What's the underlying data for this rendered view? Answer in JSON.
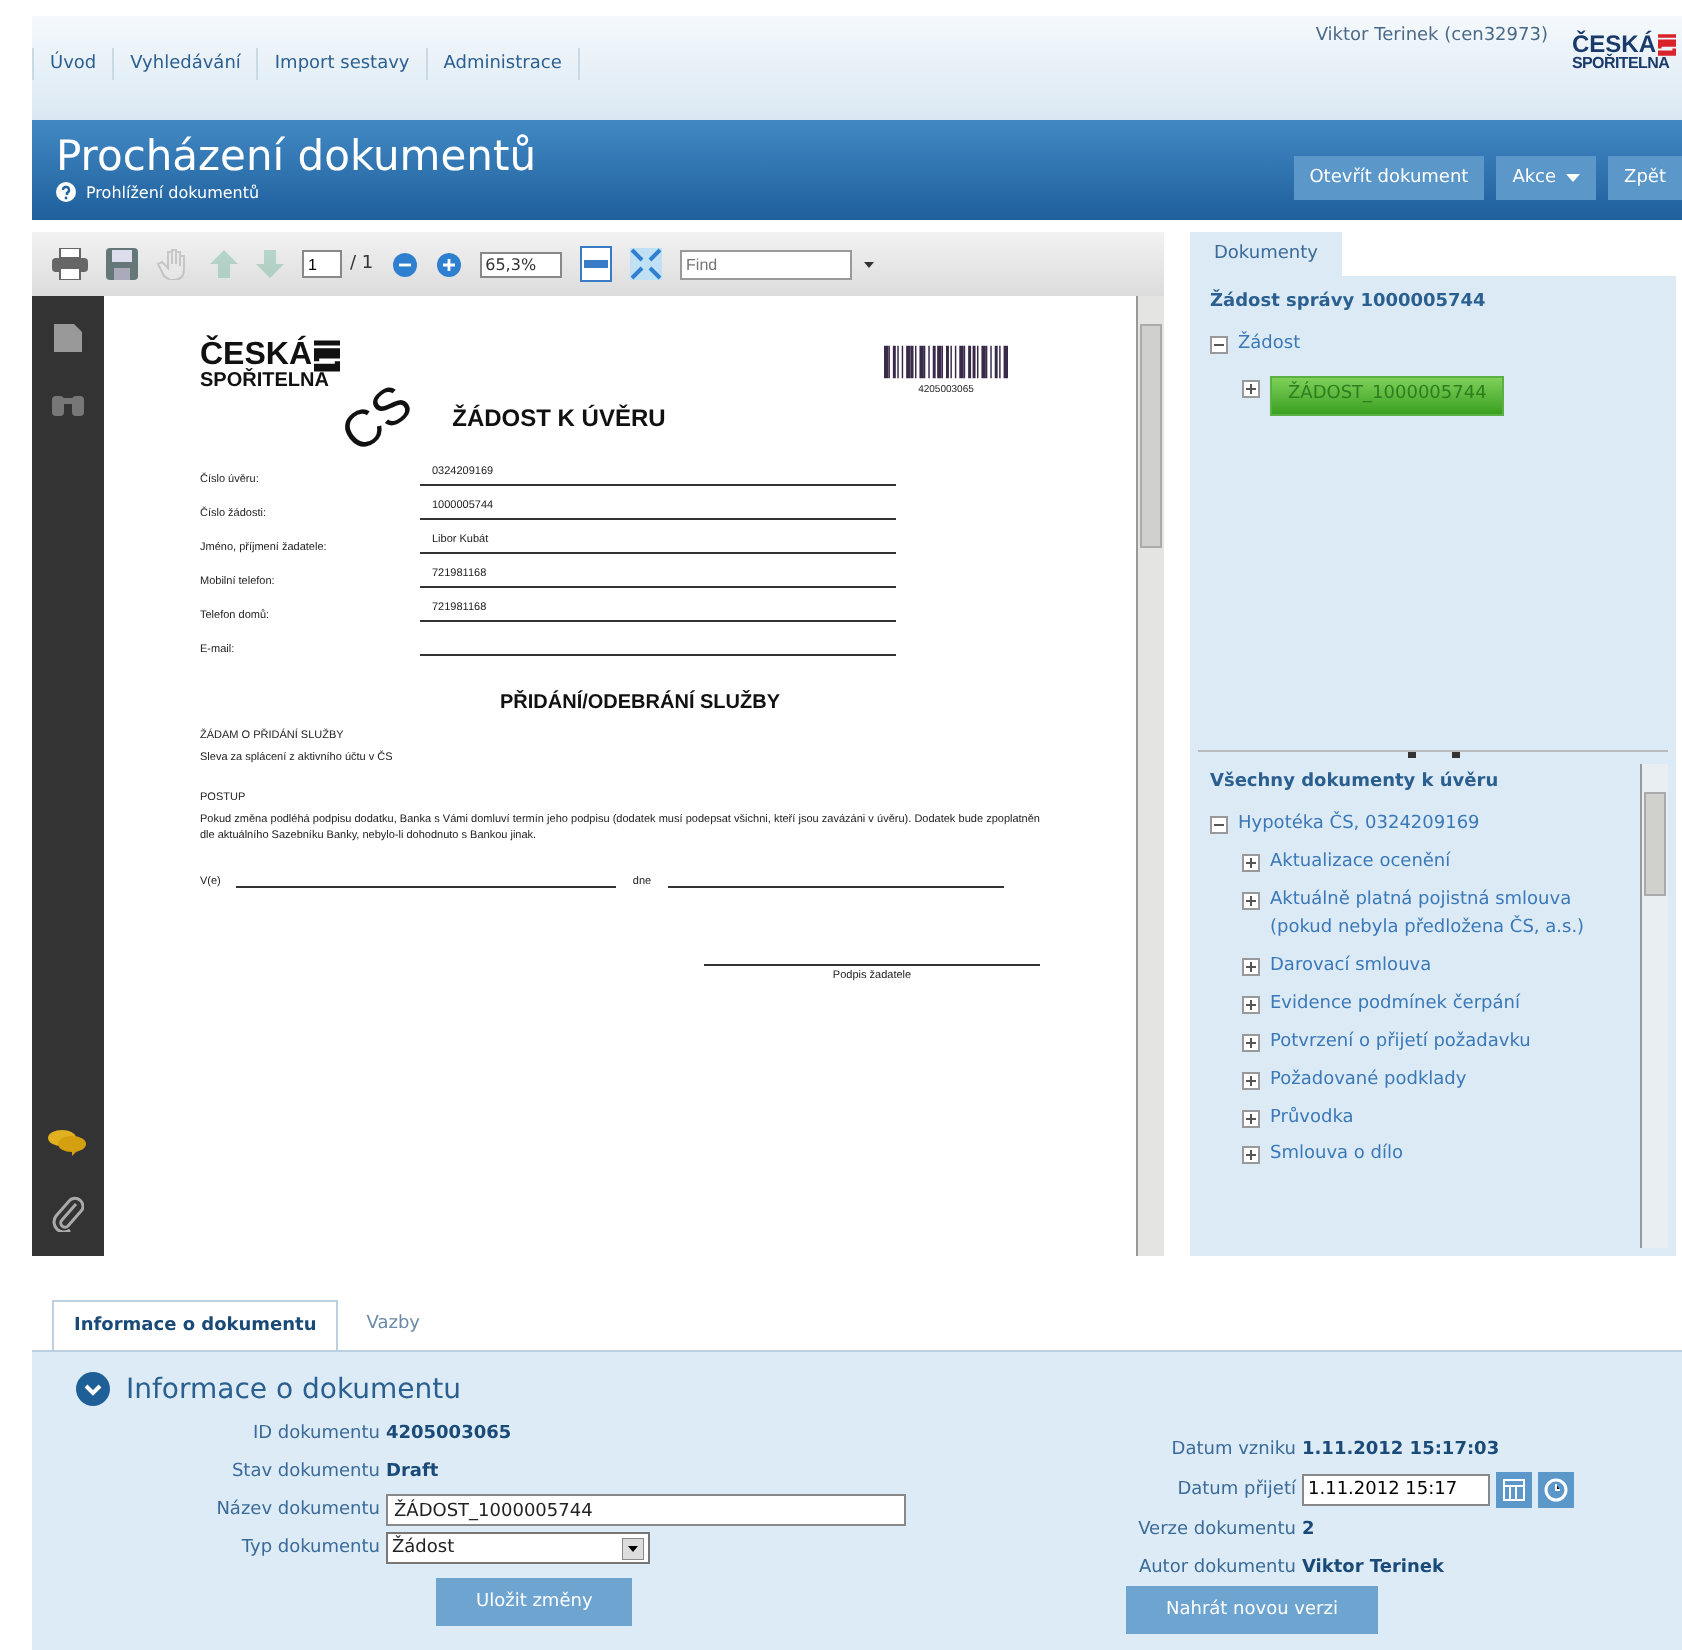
{
  "nav": {
    "items": [
      {
        "label": "Úvod"
      },
      {
        "label": "Vyhledávání"
      },
      {
        "label": "Import sestavy"
      },
      {
        "label": "Administrace"
      }
    ],
    "user": "Viktor Terinek (cen32973)",
    "logo": [
      "ČESKÁ",
      "SPOŘITELNA"
    ]
  },
  "title_bar": {
    "title": "Procházení dokumentů",
    "breadcrumb": "Prohlížení dokumentů",
    "buttons": [
      {
        "label": "Otevřít dokument",
        "dropdown": false
      },
      {
        "label": "Akce",
        "dropdown": true
      },
      {
        "label": "Zpět",
        "dropdown": false
      }
    ]
  },
  "viewer": {
    "tools": [
      {
        "kind": "print",
        "disabled": false
      },
      {
        "kind": "save",
        "disabled": false
      },
      {
        "kind": "hand",
        "disabled": true
      },
      {
        "kind": "prev",
        "disabled": true
      },
      {
        "kind": "next",
        "disabled": true
      },
      {
        "kind": "page"
      },
      {
        "kind": "zoom-out",
        "disabled": false
      },
      {
        "kind": "zoom-in",
        "disabled": false
      },
      {
        "kind": "zoom"
      },
      {
        "kind": "fit",
        "disabled": false
      },
      {
        "kind": "fullscreen",
        "disabled": false
      },
      {
        "kind": "find"
      }
    ],
    "page": "1",
    "page_count": "/ 1",
    "zoom": "65,3%",
    "find_placeholder": "Find",
    "document": {
      "logo": [
        "ČESKÁ",
        "SPOŘITELNA"
      ],
      "barcode_number": "4205003065",
      "stamp": "CS",
      "title": "ŽÁDOST K ÚVĚRU",
      "fields": [
        {
          "label": "Číslo úvěru:",
          "value": "0324209169"
        },
        {
          "label": "Číslo žádosti:",
          "value": "1000005744"
        },
        {
          "label": "Jméno, příjmení žadatele:",
          "value": "Libor Kubát"
        },
        {
          "label": "Mobilní telefon:",
          "value": "721981168"
        },
        {
          "label": "Telefon domů:",
          "value": "721981168"
        },
        {
          "label": "E-mail:"
        }
      ],
      "section_title": "PŘIDÁNÍ/ODEBRÁNÍ SLUŽBY",
      "request": "ŽÁDAM O PŘIDÁNÍ SLUŽBY",
      "service": "Sleva za splácení z aktivního účtu v ČS",
      "procedure_heading": "POSTUP",
      "procedure_text": "Pokud změna podléhá podpisu dodatku, Banka s Vámi domluví termín jeho podpisu (dodatek musí podepsat všichni, kteří jsou zavázáni v úvěru). Dodatek bude zpoplatněn dle aktuálního Sazebníku Banky, nebylo-li dohodnuto s Bankou jinak.",
      "place_label": "V(e)",
      "date_label": "dne",
      "signature_label": "Podpis žadatele"
    }
  },
  "documents_panel": {
    "tabs": [
      {
        "label": "Dokumenty",
        "selected": true
      }
    ],
    "title": "Žádost správy 1000005744",
    "tree": [
      {
        "label": "Žádost",
        "expanded": true,
        "children": [
          {
            "label": "ŽÁDOST_1000005744",
            "expanded": false,
            "selected": true
          }
        ]
      }
    ],
    "all_title": "Všechny dokumenty k úvěru",
    "all_tree": [
      {
        "label": "Hypotéka ČS, 0324209169",
        "expanded": true,
        "children": [
          {
            "label": "Aktualizace ocenění",
            "expanded": false,
            "selected": false
          },
          {
            "label": "Aktuálně platná pojistná smlouva (pokud nebyla předložena ČS, a.s.)",
            "expanded": false,
            "selected": false
          },
          {
            "label": "Darovací smlouva",
            "expanded": false,
            "selected": false
          },
          {
            "label": "Evidence podmínek čerpání",
            "expanded": false,
            "selected": false
          },
          {
            "label": "Potvrzení o přijetí požadavku",
            "expanded": false,
            "selected": false
          },
          {
            "label": "Požadované podklady",
            "expanded": false,
            "selected": false
          },
          {
            "label": "Průvodka",
            "expanded": false,
            "selected": false
          },
          {
            "label": "Smlouva o dílo",
            "expanded": false,
            "selected": false
          }
        ]
      }
    ]
  },
  "info_tabs": [
    {
      "label": "Informace o dokumentu",
      "selected": true
    },
    {
      "label": "Vazby",
      "selected": false
    }
  ],
  "info": {
    "heading": "Informace o dokumentu",
    "expanded": true,
    "left": [
      {
        "kind": "text",
        "label": "ID dokumentu",
        "value": "4205003065"
      },
      {
        "kind": "text",
        "label": "Stav dokumentu",
        "value": "Draft"
      },
      {
        "kind": "input",
        "label": "Název dokumentu",
        "value": "ŽÁDOST_1000005744"
      },
      {
        "kind": "select",
        "label": "Typ dokumentu",
        "value": "Žádost"
      }
    ],
    "right": [
      {
        "kind": "text",
        "label": "Datum vzniku",
        "value": "1.11.2012 15:17:03"
      },
      {
        "kind": "date",
        "label": "Datum přijetí",
        "value": "1.11.2012 15:17"
      },
      {
        "kind": "text",
        "label": "Verze dokumentu",
        "value": "2"
      },
      {
        "kind": "text",
        "label": "Autor dokumentu",
        "value": "Viktor Terinek"
      }
    ],
    "save_button": "Uložit změny",
    "upload_button": "Nahrát novou verzi"
  }
}
